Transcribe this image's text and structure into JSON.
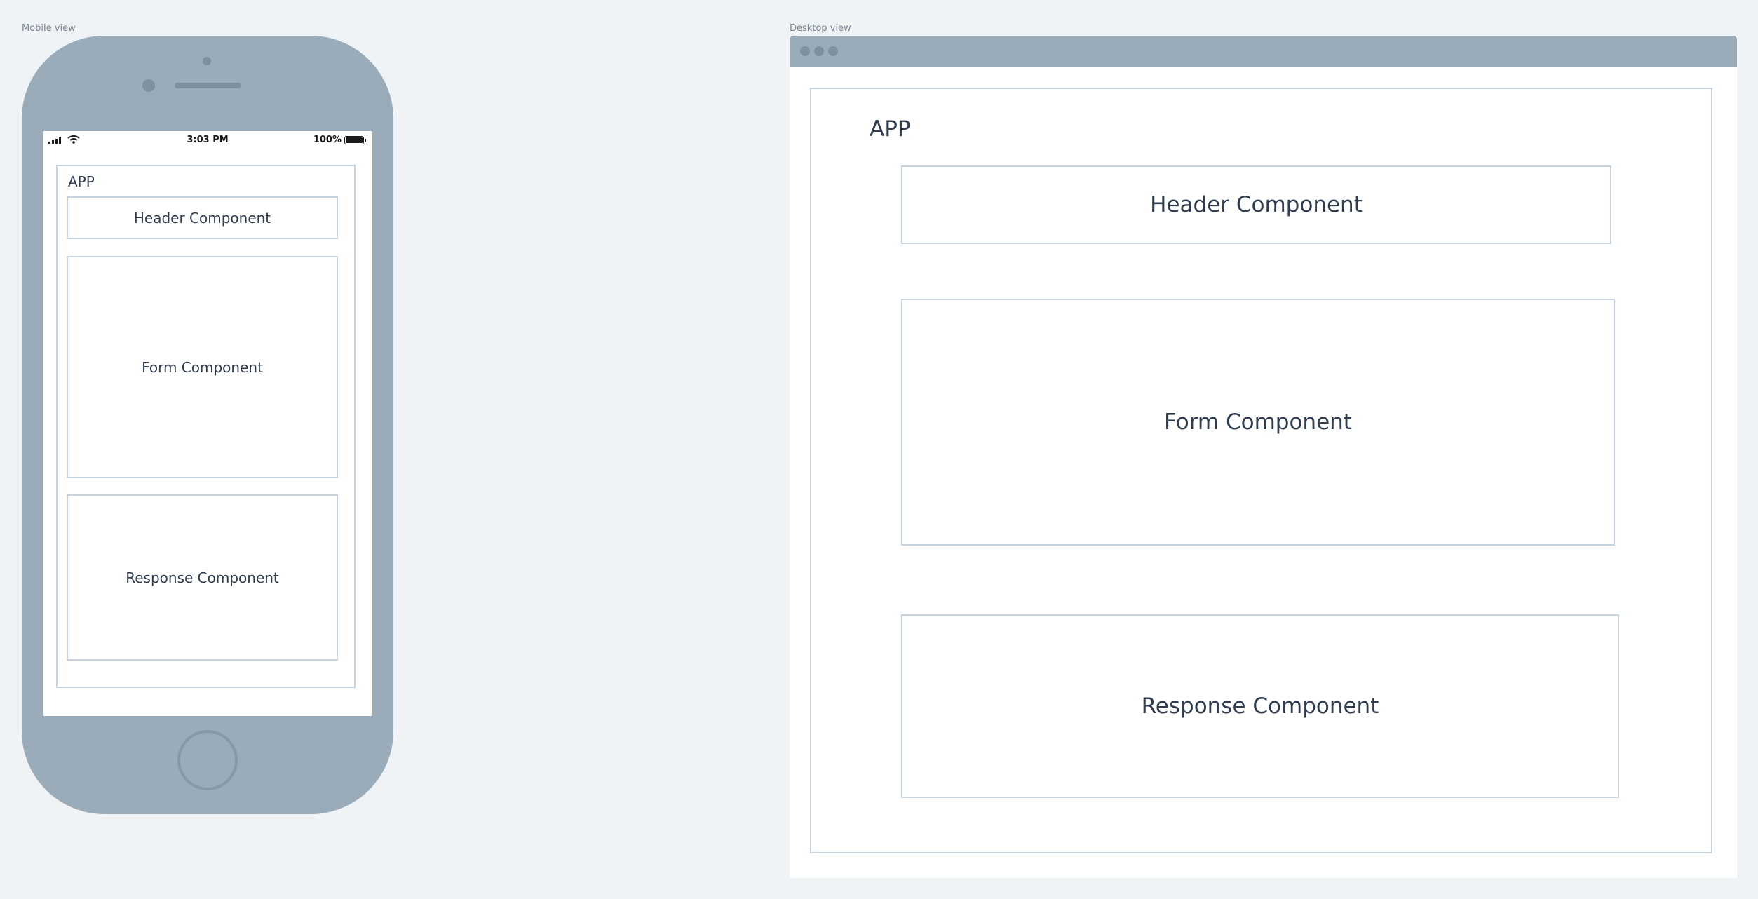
{
  "mobile": {
    "frame_label": "Mobile view",
    "status_bar": {
      "time": "3:03 PM",
      "battery": "100%"
    },
    "app_label": "APP",
    "header_label": "Header Component",
    "form_label": "Form Component",
    "response_label": "Response Component"
  },
  "desktop": {
    "frame_label": "Desktop view",
    "app_label": "APP",
    "header_label": "Header Component",
    "form_label": "Form Component",
    "response_label": "Response Component"
  }
}
